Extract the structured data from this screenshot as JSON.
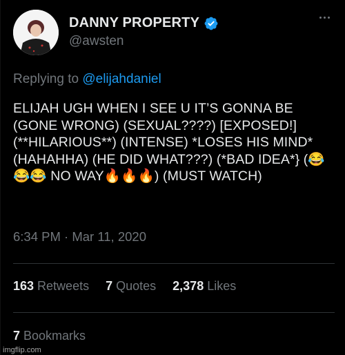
{
  "author": {
    "display_name": "DANNY PROPERTY",
    "handle": "@awsten"
  },
  "reply": {
    "prefix": "Replying to",
    "mention": "@elijahdaniel"
  },
  "tweet": {
    "text": "ELIJAH UGH WHEN I SEE U IT’S GONNA BE (GONE WRONG) (SEXUAL????) [EXPOSED!] (**HILARIOUS**) (INTENSE) *LOSES HIS MIND* (HAHAHHA) (HE DID WHAT???) (*BAD IDEA*} (😂😂😂 NO WAY🔥🔥🔥) (MUST WATCH)"
  },
  "timestamp": "6:34 PM · Mar 11, 2020",
  "stats": {
    "retweets_count": "163",
    "retweets_label": "Retweets",
    "quotes_count": "7",
    "quotes_label": "Quotes",
    "likes_count": "2,378",
    "likes_label": "Likes",
    "bookmarks_count": "7",
    "bookmarks_label": "Bookmarks"
  },
  "watermark": "imgflip.com",
  "icons": {
    "verified": "verified-badge-icon",
    "more": "more-options-icon"
  },
  "colors": {
    "background": "#000000",
    "text": "#e7e9ea",
    "muted": "#71767b",
    "link": "#1d9bf0",
    "divider": "#2f3336"
  }
}
